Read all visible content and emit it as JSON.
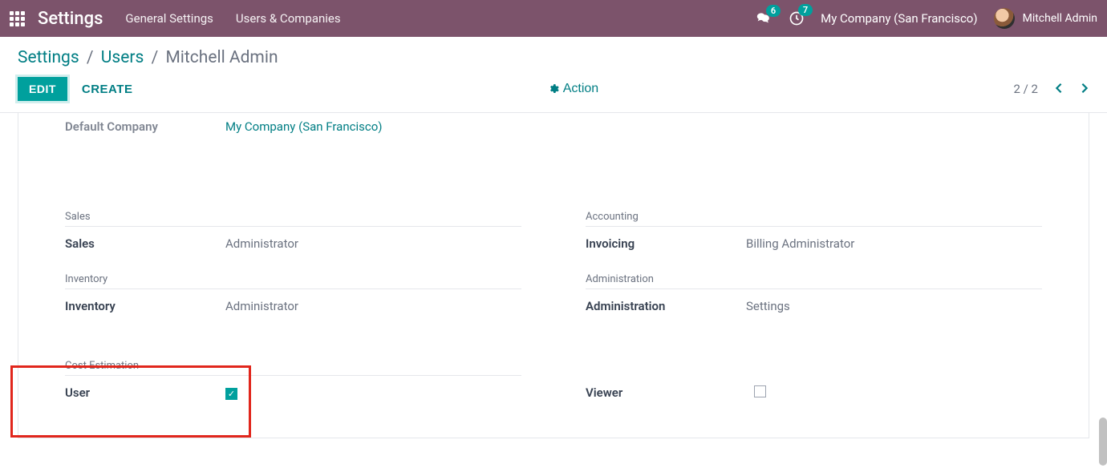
{
  "navbar": {
    "app_title": "Settings",
    "links": [
      "General Settings",
      "Users & Companies"
    ],
    "messages_badge": "6",
    "activities_badge": "7",
    "company": "My Company (San Francisco)",
    "user_name": "Mitchell Admin"
  },
  "breadcrumbs": {
    "items": [
      "Settings",
      "Users"
    ],
    "current": "Mitchell Admin"
  },
  "buttons": {
    "edit": "EDIT",
    "create": "CREATE",
    "action": "Action"
  },
  "pager": {
    "text": "2 / 2"
  },
  "form": {
    "default_company": {
      "label": "Default Company",
      "value": "My Company (San Francisco)"
    },
    "sections": {
      "sales": {
        "title": "Sales",
        "fields": [
          {
            "label": "Sales",
            "value": "Administrator"
          }
        ]
      },
      "accounting": {
        "title": "Accounting",
        "fields": [
          {
            "label": "Invoicing",
            "value": "Billing Administrator"
          }
        ]
      },
      "inventory": {
        "title": "Inventory",
        "fields": [
          {
            "label": "Inventory",
            "value": "Administrator"
          }
        ]
      },
      "administration": {
        "title": "Administration",
        "fields": [
          {
            "label": "Administration",
            "value": "Settings"
          }
        ]
      },
      "cost_estimation": {
        "title": "Cost Estimation",
        "user_label": "User",
        "user_checked": true,
        "viewer_label": "Viewer",
        "viewer_checked": false
      }
    }
  }
}
